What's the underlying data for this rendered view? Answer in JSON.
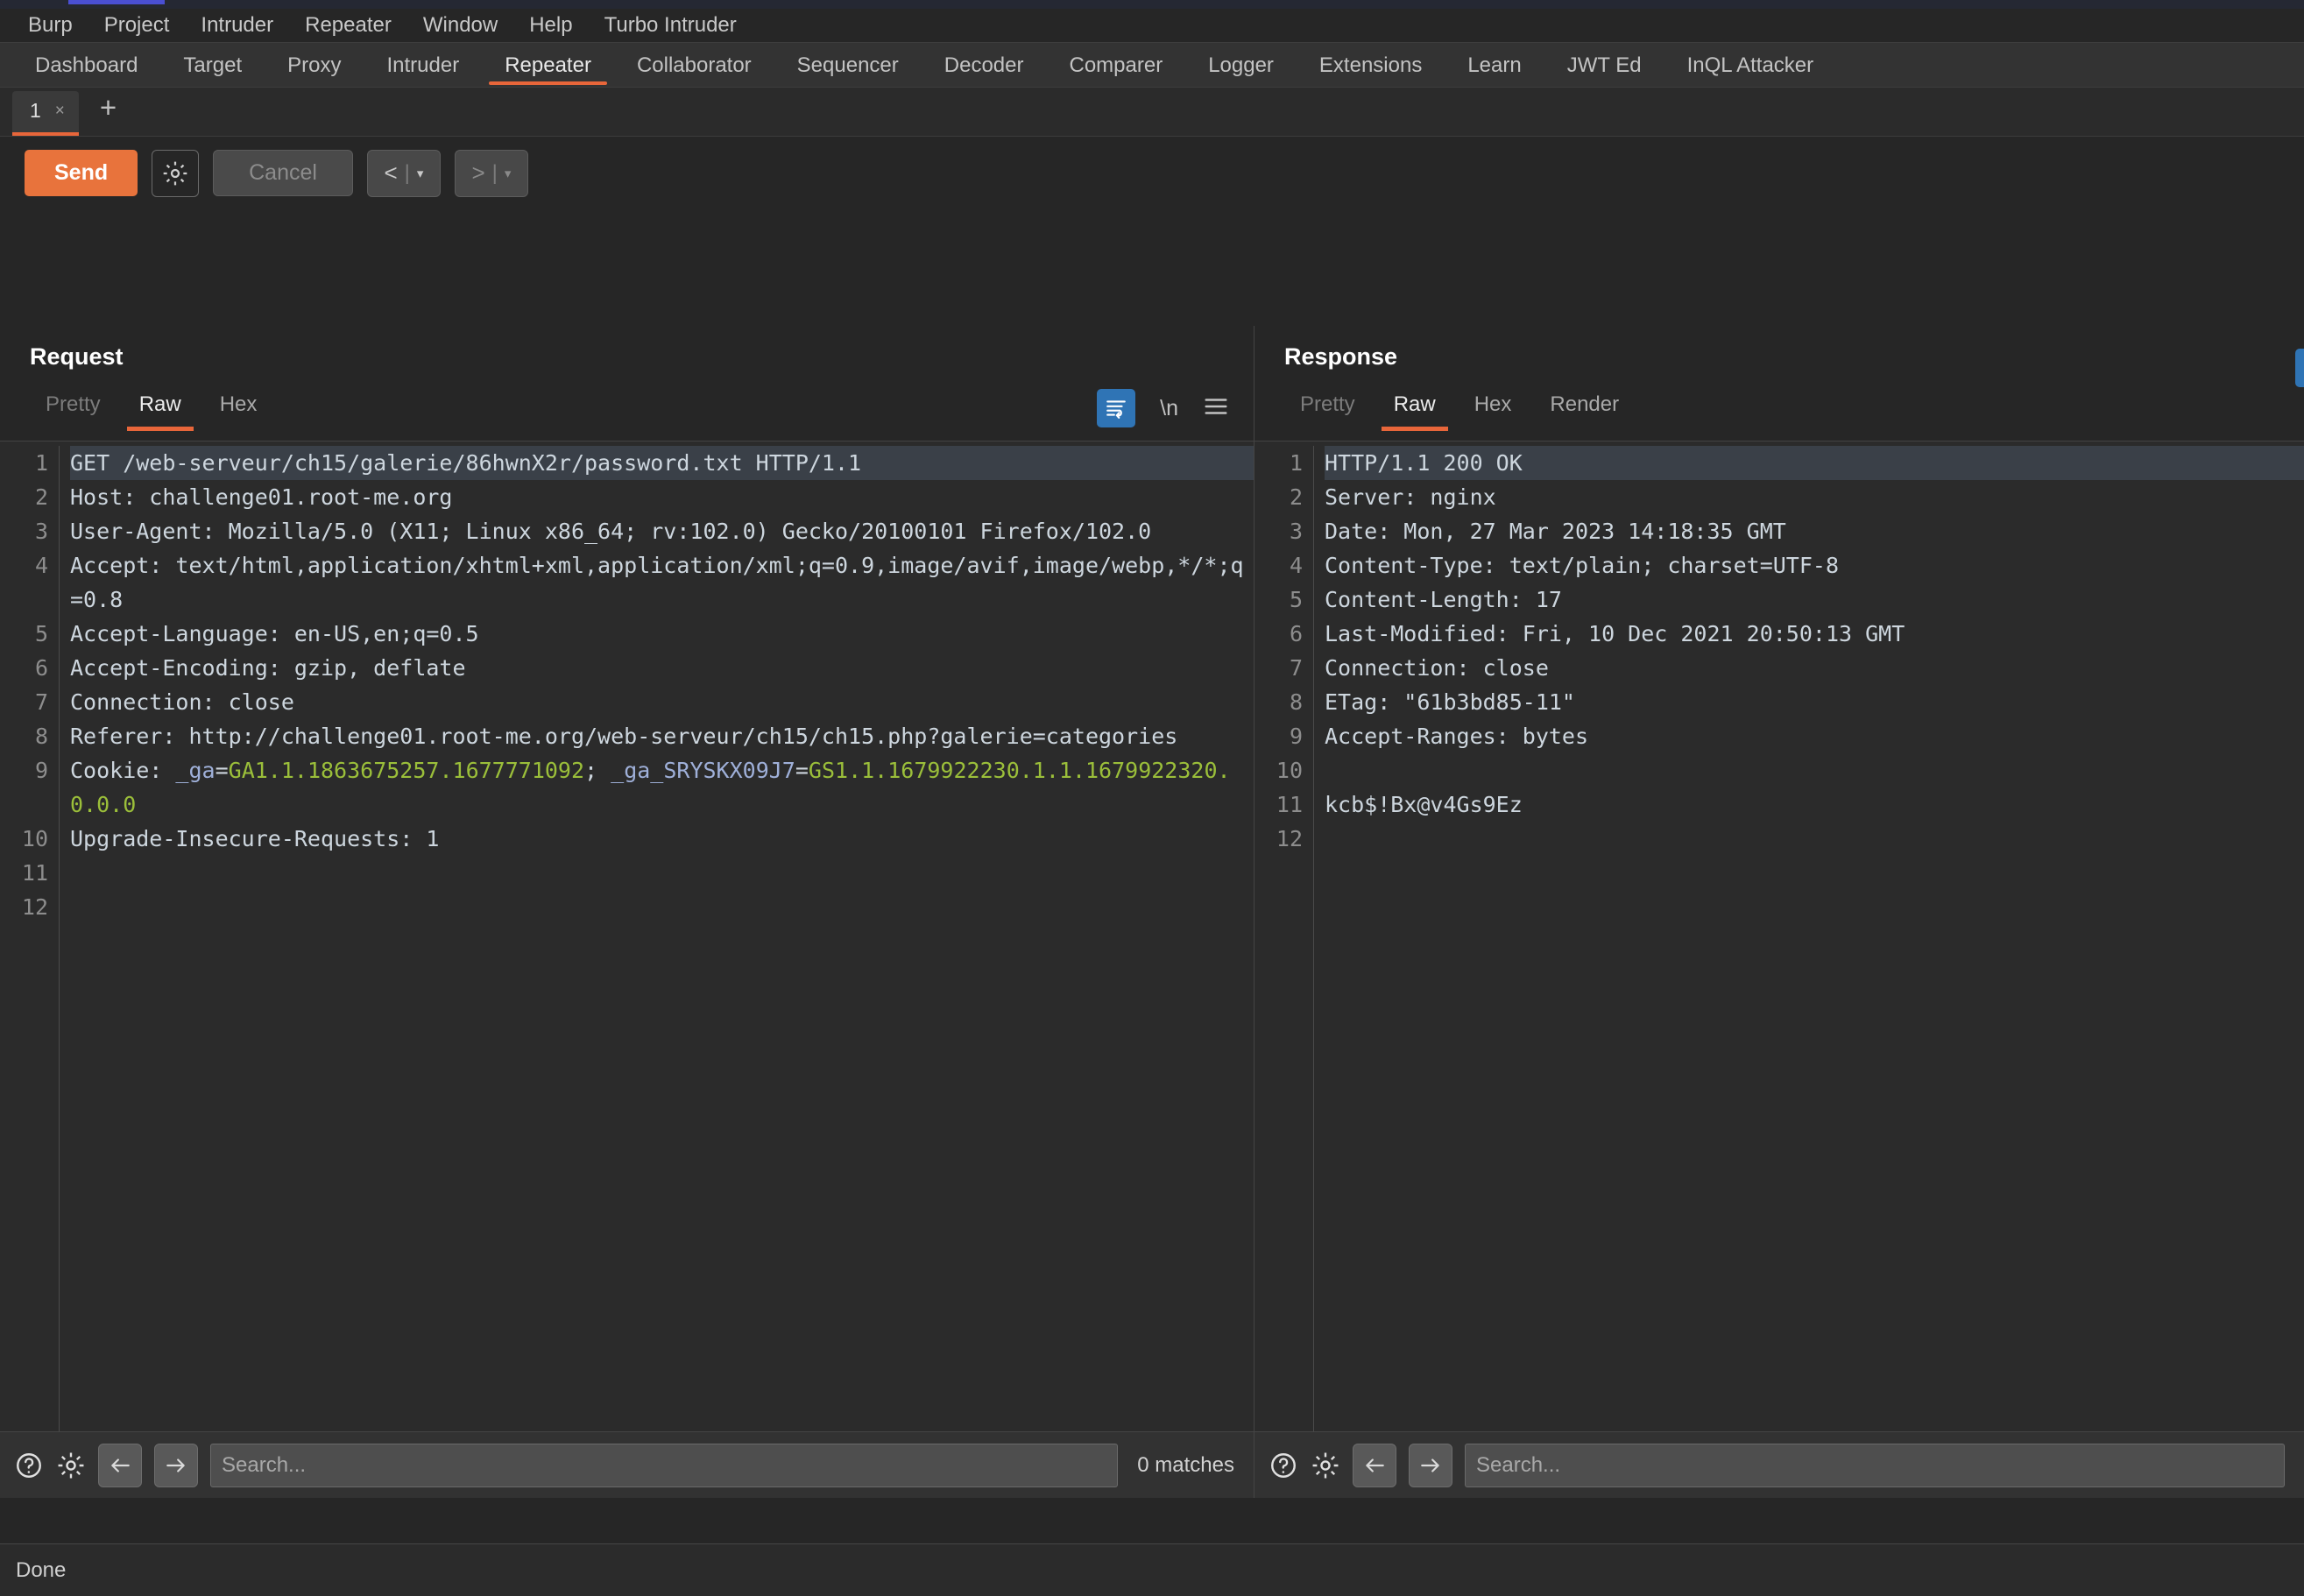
{
  "app": {
    "menu": [
      "Burp",
      "Project",
      "Intruder",
      "Repeater",
      "Window",
      "Help",
      "Turbo Intruder"
    ],
    "tabs": [
      {
        "label": "Dashboard",
        "active": false
      },
      {
        "label": "Target",
        "active": false
      },
      {
        "label": "Proxy",
        "active": false
      },
      {
        "label": "Intruder",
        "active": false
      },
      {
        "label": "Repeater",
        "active": true
      },
      {
        "label": "Collaborator",
        "active": false
      },
      {
        "label": "Sequencer",
        "active": false
      },
      {
        "label": "Decoder",
        "active": false
      },
      {
        "label": "Comparer",
        "active": false
      },
      {
        "label": "Logger",
        "active": false
      },
      {
        "label": "Extensions",
        "active": false
      },
      {
        "label": "Learn",
        "active": false
      },
      {
        "label": "JWT Ed",
        "active": false
      },
      {
        "label": "InQL Attacker",
        "active": false
      }
    ],
    "accent_color": "#e8663a"
  },
  "repeater": {
    "tab_label": "1",
    "tab_close": "×",
    "add_tab": "+"
  },
  "toolbar": {
    "send_label": "Send",
    "settings_icon": "gear-icon",
    "cancel_label": "Cancel",
    "back_label": "<",
    "back_caret": "▾",
    "forward_label": ">",
    "forward_caret": "▾",
    "separator": "|"
  },
  "request": {
    "title": "Request",
    "subtabs": [
      {
        "label": "Pretty",
        "active": false,
        "dimmed": true
      },
      {
        "label": "Raw",
        "active": true,
        "dimmed": false
      },
      {
        "label": "Hex",
        "active": false,
        "dimmed": false
      }
    ],
    "tools": {
      "wrap_icon": "word-wrap-icon",
      "newline_label": "\\n",
      "menu_icon": "hamburger-menu-icon"
    },
    "line_numbers": [
      "1",
      "",
      "2",
      "3",
      "",
      "4",
      "",
      "",
      "5",
      "6",
      "7",
      "8",
      "",
      "",
      "9",
      "",
      "10",
      "11",
      "12"
    ],
    "lines": [
      {
        "n": 1,
        "text": "GET /web-serveur/ch15/galerie/86hwnX2r/password.txt HTTP/1.1",
        "highlighted": true
      },
      {
        "n": 2,
        "text": "Host: challenge01.root-me.org",
        "highlighted": false
      },
      {
        "n": 3,
        "text": "User-Agent: Mozilla/5.0 (X11; Linux x86_64; rv:102.0) Gecko/20100101 Firefox/102.0",
        "highlighted": false
      },
      {
        "n": 4,
        "text": "Accept: text/html,application/xhtml+xml,application/xml;q=0.9,image/avif,image/webp,*/*;q=0.8",
        "highlighted": false
      },
      {
        "n": 5,
        "text": "Accept-Language: en-US,en;q=0.5",
        "highlighted": false
      },
      {
        "n": 6,
        "text": "Accept-Encoding: gzip, deflate",
        "highlighted": false
      },
      {
        "n": 7,
        "text": "Connection: close",
        "highlighted": false
      },
      {
        "n": 8,
        "text": "Referer: http://challenge01.root-me.org/web-serveur/ch15/ch15.php?galerie=categories",
        "highlighted": false
      },
      {
        "n": 9,
        "text": "Cookie: _ga=GA1.1.1863675257.1677771092; _ga_SRYSKX09J7=GS1.1.1679922230.1.1.1679922320.0.0.0",
        "highlighted": false,
        "cookie": true
      },
      {
        "n": 10,
        "text": "Upgrade-Insecure-Requests: 1",
        "highlighted": false
      },
      {
        "n": 11,
        "text": "",
        "highlighted": false
      },
      {
        "n": 12,
        "text": "",
        "highlighted": false
      }
    ],
    "cookie_parts": [
      {
        "t": "Cookie: ",
        "c": "plain"
      },
      {
        "t": "_ga",
        "c": "name"
      },
      {
        "t": "=",
        "c": "plain"
      },
      {
        "t": "GA1.1.1863675257.1677771092",
        "c": "value"
      },
      {
        "t": "; ",
        "c": "plain"
      },
      {
        "t": "_ga_SRYSKX09J7",
        "c": "name"
      },
      {
        "t": "=",
        "c": "plain"
      },
      {
        "t": "GS1.1.1679922230.1.1.1679922320.0.0.0",
        "c": "value"
      }
    ],
    "search": {
      "placeholder": "Search...",
      "matches": "0 matches",
      "help_icon": "help-icon",
      "settings_icon": "gear-icon",
      "prev_icon": "arrow-left-icon",
      "next_icon": "arrow-right-icon"
    }
  },
  "response": {
    "title": "Response",
    "subtabs": [
      {
        "label": "Pretty",
        "active": false,
        "dimmed": true
      },
      {
        "label": "Raw",
        "active": true,
        "dimmed": false
      },
      {
        "label": "Hex",
        "active": false,
        "dimmed": false
      },
      {
        "label": "Render",
        "active": false,
        "dimmed": false
      }
    ],
    "lines": [
      {
        "n": 1,
        "text": "HTTP/1.1 200 OK",
        "highlighted": true
      },
      {
        "n": 2,
        "text": "Server: nginx",
        "highlighted": false
      },
      {
        "n": 3,
        "text": "Date: Mon, 27 Mar 2023 14:18:35 GMT",
        "highlighted": false
      },
      {
        "n": 4,
        "text": "Content-Type: text/plain; charset=UTF-8",
        "highlighted": false
      },
      {
        "n": 5,
        "text": "Content-Length: 17",
        "highlighted": false
      },
      {
        "n": 6,
        "text": "Last-Modified: Fri, 10 Dec 2021 20:50:13 GMT",
        "highlighted": false
      },
      {
        "n": 7,
        "text": "Connection: close",
        "highlighted": false
      },
      {
        "n": 8,
        "text": "ETag: \"61b3bd85-11\"",
        "highlighted": false
      },
      {
        "n": 9,
        "text": "Accept-Ranges: bytes",
        "highlighted": false
      },
      {
        "n": 10,
        "text": "",
        "highlighted": false
      },
      {
        "n": 11,
        "text": "kcb$!Bx@v4Gs9Ez",
        "highlighted": false
      },
      {
        "n": 12,
        "text": "",
        "highlighted": false
      }
    ],
    "search": {
      "placeholder": "Search...",
      "help_icon": "help-icon",
      "settings_icon": "gear-icon",
      "prev_icon": "arrow-left-icon",
      "next_icon": "arrow-right-icon"
    }
  },
  "status": {
    "text": "Done"
  }
}
